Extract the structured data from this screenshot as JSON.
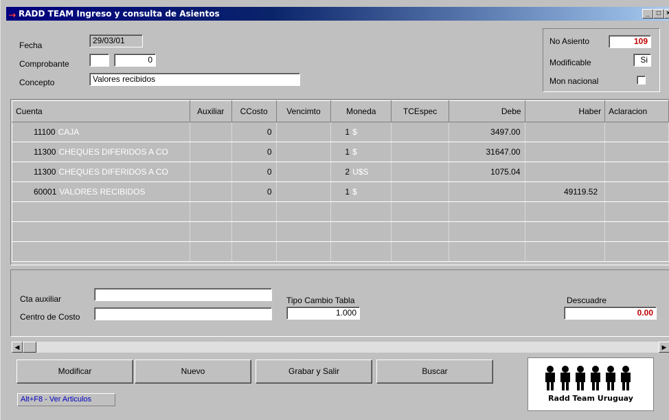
{
  "window": {
    "title": "RADD TEAM Ingreso y consulta de Asientos",
    "buttons": [
      "_",
      "□",
      "×"
    ]
  },
  "header": {
    "fecha_label": "Fecha",
    "fecha_value": "29/03/01",
    "comprobante_label": "Comprobante",
    "comprobante_tipo": "",
    "comprobante_numero": "0",
    "concepto_label": "Concepto",
    "concepto_value": "Valores recibidos"
  },
  "info_panel": {
    "no_asiento_label": "No Asiento",
    "no_asiento_value": "109",
    "modificable_label": "Modificable",
    "modificable_value": "Si",
    "mon_nacional_label": "Mon nacional",
    "mon_nacional_checked": false
  },
  "grid": {
    "columns": [
      "Cuenta",
      "Auxiliar",
      "CCosto",
      "Vencimto",
      "Moneda",
      "TCEspec",
      "Debe",
      "Haber",
      "Aclaracion"
    ],
    "rows": [
      {
        "cuenta": "11100",
        "desc": "CAJA",
        "auxiliar": "",
        "ccosto": "0",
        "vencimto": "",
        "moneda": "1",
        "moneda_sym": "$",
        "tcespec": "",
        "debe": "3497.00",
        "haber": "",
        "aclaracion": ""
      },
      {
        "cuenta": "11300",
        "desc": "CHEQUES DIFERIDOS A CO",
        "auxiliar": "",
        "ccosto": "0",
        "vencimto": "",
        "moneda": "1",
        "moneda_sym": "$",
        "tcespec": "",
        "debe": "31647.00",
        "haber": "",
        "aclaracion": ""
      },
      {
        "cuenta": "11300",
        "desc": "CHEQUES DIFERIDOS A CO",
        "auxiliar": "",
        "ccosto": "0",
        "vencimto": "",
        "moneda": "2",
        "moneda_sym": "U$S",
        "tcespec": "",
        "debe": "1075.04",
        "haber": "",
        "aclaracion": ""
      },
      {
        "cuenta": "60001",
        "desc": "VALORES RECIBIDOS",
        "auxiliar": "",
        "ccosto": "0",
        "vencimto": "",
        "moneda": "1",
        "moneda_sym": "$",
        "tcespec": "",
        "debe": "",
        "haber": "49119.52",
        "aclaracion": ""
      }
    ]
  },
  "details": {
    "cta_auxiliar_label": "Cta auxiliar",
    "cta_auxiliar_value": "",
    "centro_costo_label": "Centro de Costo",
    "centro_costo_value": "",
    "tipo_cambio_label": "Tipo Cambio Tabla",
    "tipo_cambio_value": "1.000",
    "descuadre_label": "Descuadre",
    "descuadre_value": "0.00"
  },
  "scrollbar": {
    "left_arrow": "◀",
    "right_arrow": "▶"
  },
  "actions": {
    "modificar": "Modificar",
    "nuevo": "Nuevo",
    "grabar_salir": "Grabar y Salir",
    "buscar": "Buscar"
  },
  "hotkey_hint": "Alt+F8 - Ver Articulos",
  "logo": {
    "text": "Radd Team Uruguay",
    "figure_count": 6
  },
  "colors": {
    "title_bar": "#000080",
    "accent_red": "#c00000",
    "hotkey_blue": "#0000c0"
  }
}
